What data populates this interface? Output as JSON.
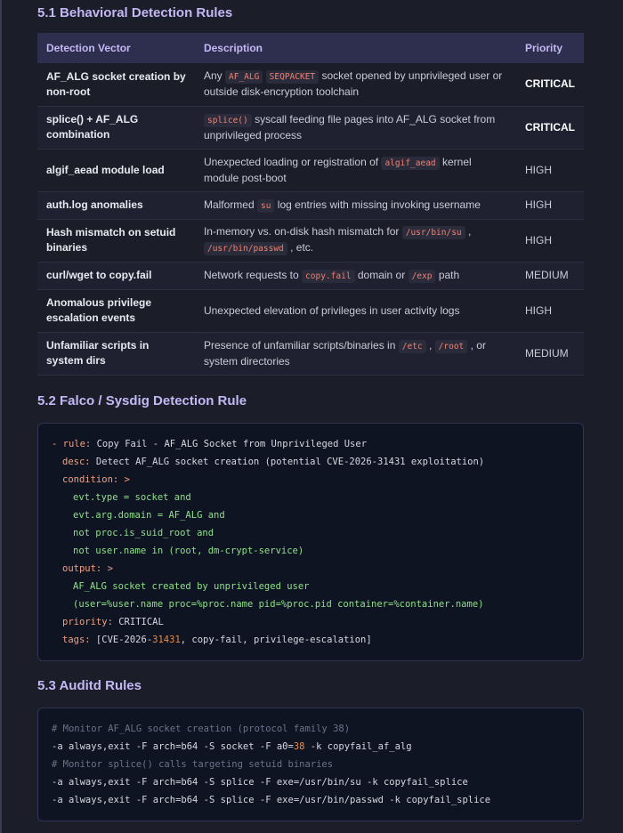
{
  "sections": {
    "s1_title": "5.1 Behavioral Detection Rules",
    "s2_title": "5.2 Falco / Sysdig Detection Rule",
    "s3_title": "5.3 Auditd Rules"
  },
  "table": {
    "headers": [
      "Detection Vector",
      "Description",
      "Priority"
    ],
    "rows": [
      {
        "vector": "AF_ALG socket creation by non-root",
        "d1": "Any",
        "c1": "AF_ALG",
        "c2": "SEQPACKET",
        "d2": "socket opened by unprivileged user or outside disk-encryption toolchain",
        "priority": "CRITICAL"
      },
      {
        "vector": "splice() + AF_ALG combination",
        "c1": "splice()",
        "d1": "syscall feeding file pages into AF_ALG socket from unprivileged process",
        "priority": "CRITICAL"
      },
      {
        "vector": "algif_aead module load",
        "d1": "Unexpected loading or registration of",
        "c1": "algif_aead",
        "d2": "kernel module post-boot",
        "priority": "HIGH"
      },
      {
        "vector": "auth.log anomalies",
        "d1": "Malformed",
        "c1": "su",
        "d2": "log entries with missing invoking username",
        "priority": "HIGH"
      },
      {
        "vector": "Hash mismatch on setuid binaries",
        "d1": "In-memory vs. on-disk hash mismatch for",
        "c1": "/usr/bin/su",
        "d2": ",",
        "c2": "/usr/bin/passwd",
        "d3": ", etc.",
        "priority": "HIGH"
      },
      {
        "vector": "curl/wget to copy.fail",
        "d1": "Network requests to",
        "c1": "copy.fail",
        "d2": "domain or",
        "c2": "/exp",
        "d3": "path",
        "priority": "MEDIUM"
      },
      {
        "vector": "Anomalous privilege escalation events",
        "d1": "Unexpected elevation of privileges in user activity logs",
        "priority": "HIGH"
      },
      {
        "vector": "Unfamiliar scripts in system dirs",
        "d1": "Presence of unfamiliar scripts/binaries in",
        "c1": "/etc",
        "d2": ",",
        "c2": "/root",
        "d3": ", or system directories",
        "priority": "MEDIUM"
      }
    ]
  },
  "falco": {
    "l1a": "- rule:",
    "l1b": " Copy Fail - AF_ALG Socket from Unprivileged User",
    "l2a": "desc:",
    "l2b": " Detect AF_ALG socket creation (potential CVE-2026-31431 exploitation)",
    "l3": "condition: >",
    "l4": "evt.type = socket and",
    "l5": "evt.arg.domain = AF_ALG and",
    "l6": "not proc.is_suid_root and",
    "l7": "not user.name in (root, dm-crypt-service)",
    "l8": "output: >",
    "l9": "AF_ALG socket created by unprivileged user",
    "l10": "(user=%user.name proc=%proc.name pid=%proc.pid container=%container.name)",
    "l11a": "priority:",
    "l11b": " CRITICAL",
    "l12a": "tags:",
    "l12b": " [CVE-2026-",
    "l12c": "31431",
    "l12d": ", copy-fail, privilege-escalation]"
  },
  "auditd": {
    "c1": "# Monitor AF_ALG socket creation (protocol family 38)",
    "r1a": "-a always,exit -F arch=b64 -S socket -F a0=",
    "r1b": "38",
    "r1c": " -k copyfail_af_alg",
    "c2": "# Monitor splice() calls targeting setuid binaries",
    "r2": "-a always,exit -F arch=b64 -S splice -F exe=/usr/bin/su -k copyfail_splice",
    "r3": "-a always,exit -F arch=b64 -S splice -F exe=/usr/bin/passwd -k copyfail_splice"
  },
  "colors": {
    "heading": "#c3b8f5",
    "code_red": "#f08070",
    "code_green": "#8fe08a",
    "bg": "#1b1d28"
  }
}
